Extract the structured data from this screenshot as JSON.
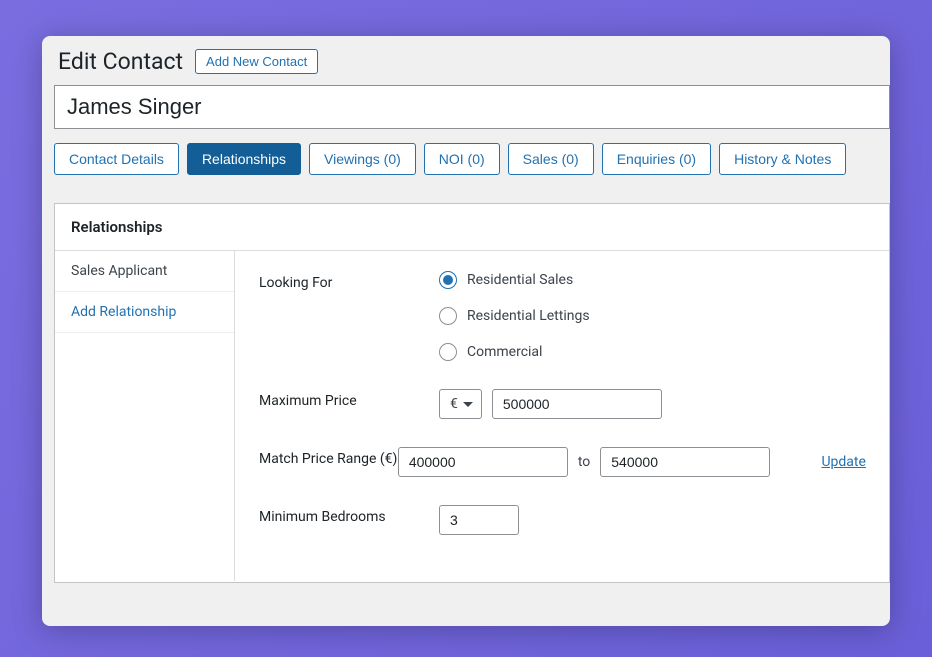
{
  "header": {
    "title": "Edit Contact",
    "add_button": "Add New Contact"
  },
  "contact": {
    "name": "James Singer"
  },
  "tabs": [
    {
      "label": "Contact Details",
      "active": false
    },
    {
      "label": "Relationships",
      "active": true
    },
    {
      "label": "Viewings (0)",
      "active": false
    },
    {
      "label": "NOI (0)",
      "active": false
    },
    {
      "label": "Sales (0)",
      "active": false
    },
    {
      "label": "Enquiries (0)",
      "active": false
    },
    {
      "label": "History & Notes",
      "active": false
    }
  ],
  "panel": {
    "title": "Relationships",
    "sidebar": {
      "current": "Sales Applicant",
      "add_label": "Add Relationship"
    },
    "form": {
      "looking_for": {
        "label": "Looking For",
        "options": {
          "residential_sales": "Residential Sales",
          "residential_lettings": "Residential Lettings",
          "commercial": "Commercial"
        },
        "selected": "residential_sales"
      },
      "max_price": {
        "label": "Maximum Price",
        "currency": "€",
        "value": "500000"
      },
      "match_range": {
        "label": "Match Price Range (€)",
        "from": "400000",
        "to_word": "to",
        "to": "540000",
        "update": "Update"
      },
      "min_bedrooms": {
        "label": "Minimum Bedrooms",
        "value": "3"
      }
    }
  }
}
